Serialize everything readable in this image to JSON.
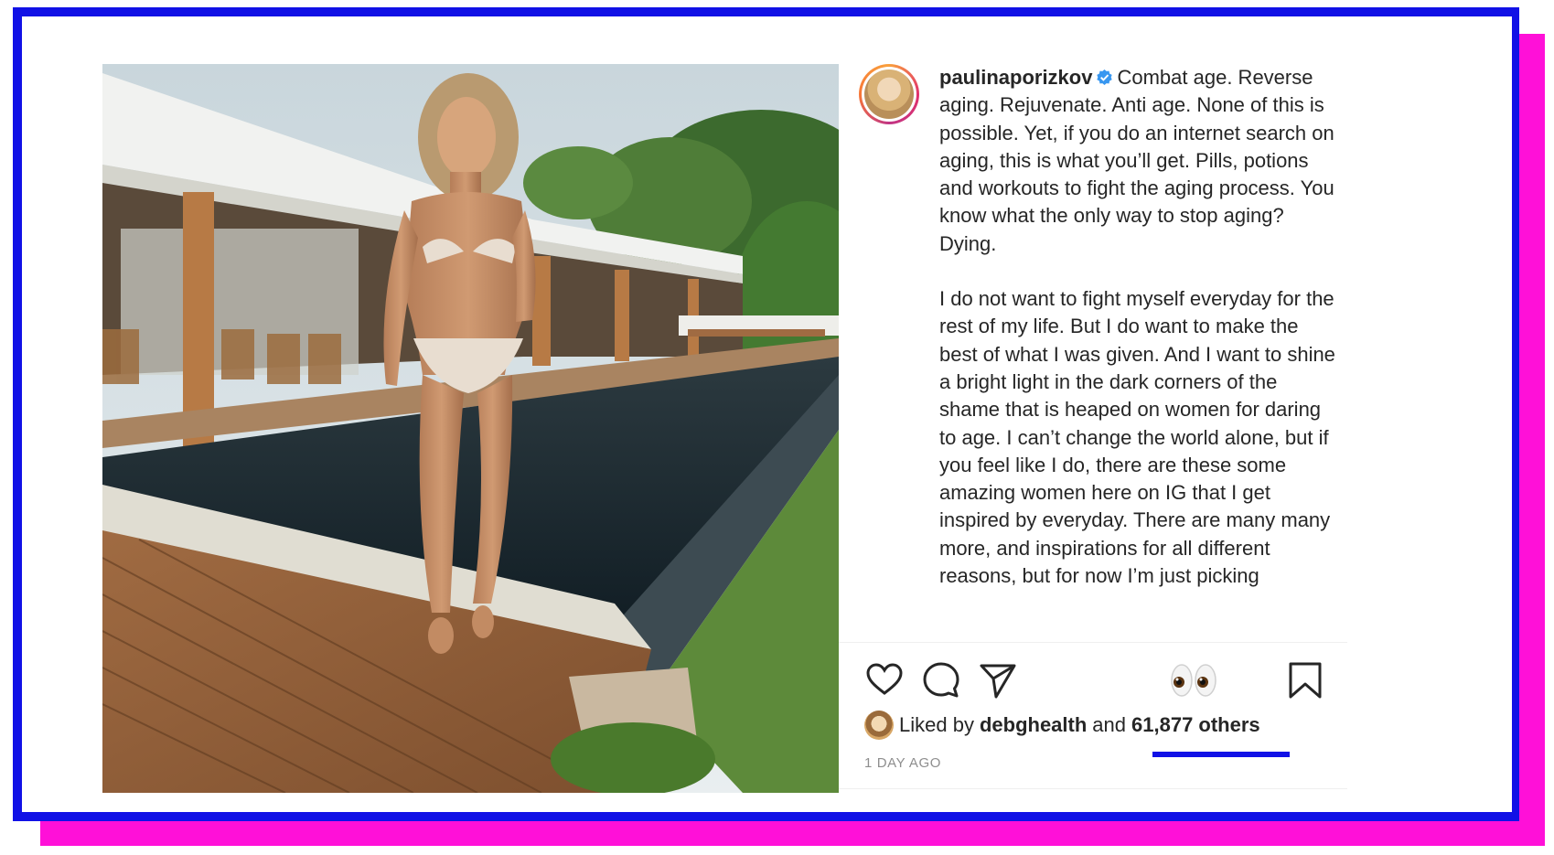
{
  "post": {
    "username": "paulinaporizkov",
    "verified": true,
    "caption_first": "Combat age. Reverse aging. Rejuvenate. Anti age. None of this is possible. Yet, if you do an internet search on aging, this is what you’ll get. Pills, potions and workouts to fight the aging process. You know what the only way to stop aging? Dying.",
    "caption_second": "I do not want to fight myself everyday for the rest of my life. But I do want to make the best of what I was given. And I want to shine a bright light in the dark corners of the shame that is heaped on women for daring to age. I can’t change the world alone, but if you feel like I do, there are these some amazing women here on IG that I get inspired by everyday. There are many many more, and inspirations for all different reasons, but for now I’m just picking",
    "liked_prefix": "Liked by",
    "liked_user": "debghealth",
    "liked_and": "and",
    "liked_others": "61,877 others",
    "timestamp": "1 DAY AGO"
  },
  "icons": {
    "like": "heart-icon",
    "comment": "comment-icon",
    "share": "send-icon",
    "reaction": "eyes-emoji-icon",
    "save": "bookmark-icon",
    "verified": "verified-badge-icon"
  },
  "colors": {
    "frame_blue": "#1111e6",
    "frame_pink": "#ff10d8",
    "text": "#262626",
    "muted": "#8e8e8e",
    "verified": "#3897f0"
  }
}
